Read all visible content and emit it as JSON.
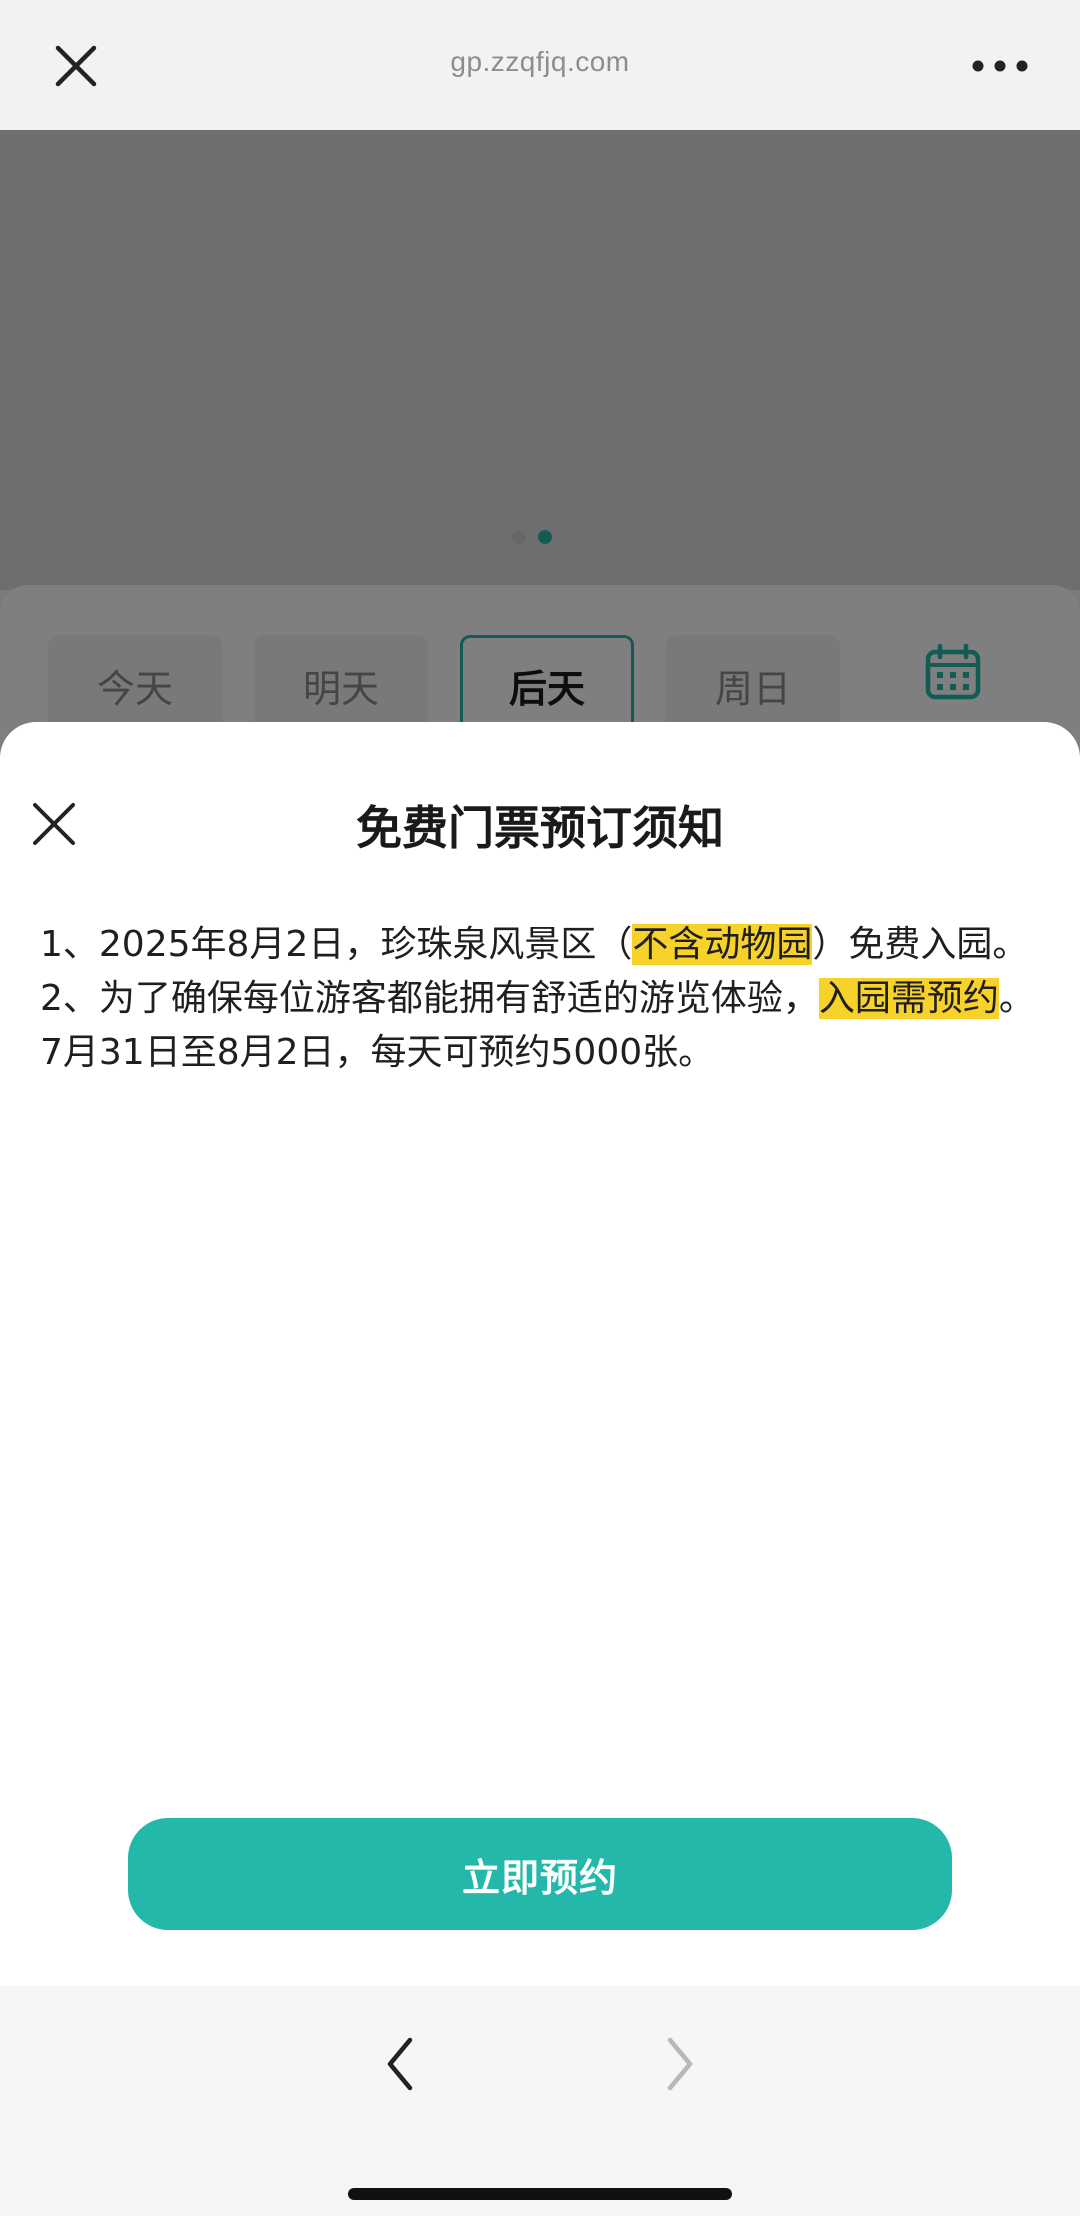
{
  "browser": {
    "url": "gp.zzqfjq.com",
    "close_icon": "close-icon",
    "more_icon": "more-horizontal-icon"
  },
  "background_page": {
    "date_chips": [
      {
        "label": "今天",
        "selected": false
      },
      {
        "label": "明天",
        "selected": false
      },
      {
        "label": "后天",
        "selected": true
      },
      {
        "label": "周日",
        "selected": false
      }
    ],
    "calendar_icon": "calendar-icon",
    "banner_page_count": 2,
    "banner_active_index": 1
  },
  "sheet": {
    "title": "免费门票预订须知",
    "close_icon": "close-icon",
    "item1_pre": "1、2025年8月2日，珍珠泉风景区（",
    "item1_highlight": "不含动物园",
    "item1_post": "）免费入园。",
    "item2_pre": "2、为了确保每位游客都能拥有舒适的游览体验，",
    "item2_highlight": "入园需预约",
    "item2_post": "。7月31日至8月2日，每天可预约5000张。",
    "book_button": "立即预约"
  },
  "colors": {
    "accent": "#24b8aa",
    "highlight": "#f7d22a"
  },
  "bottom_nav": {
    "back_icon": "chevron-left-icon",
    "forward_icon": "chevron-right-icon"
  }
}
